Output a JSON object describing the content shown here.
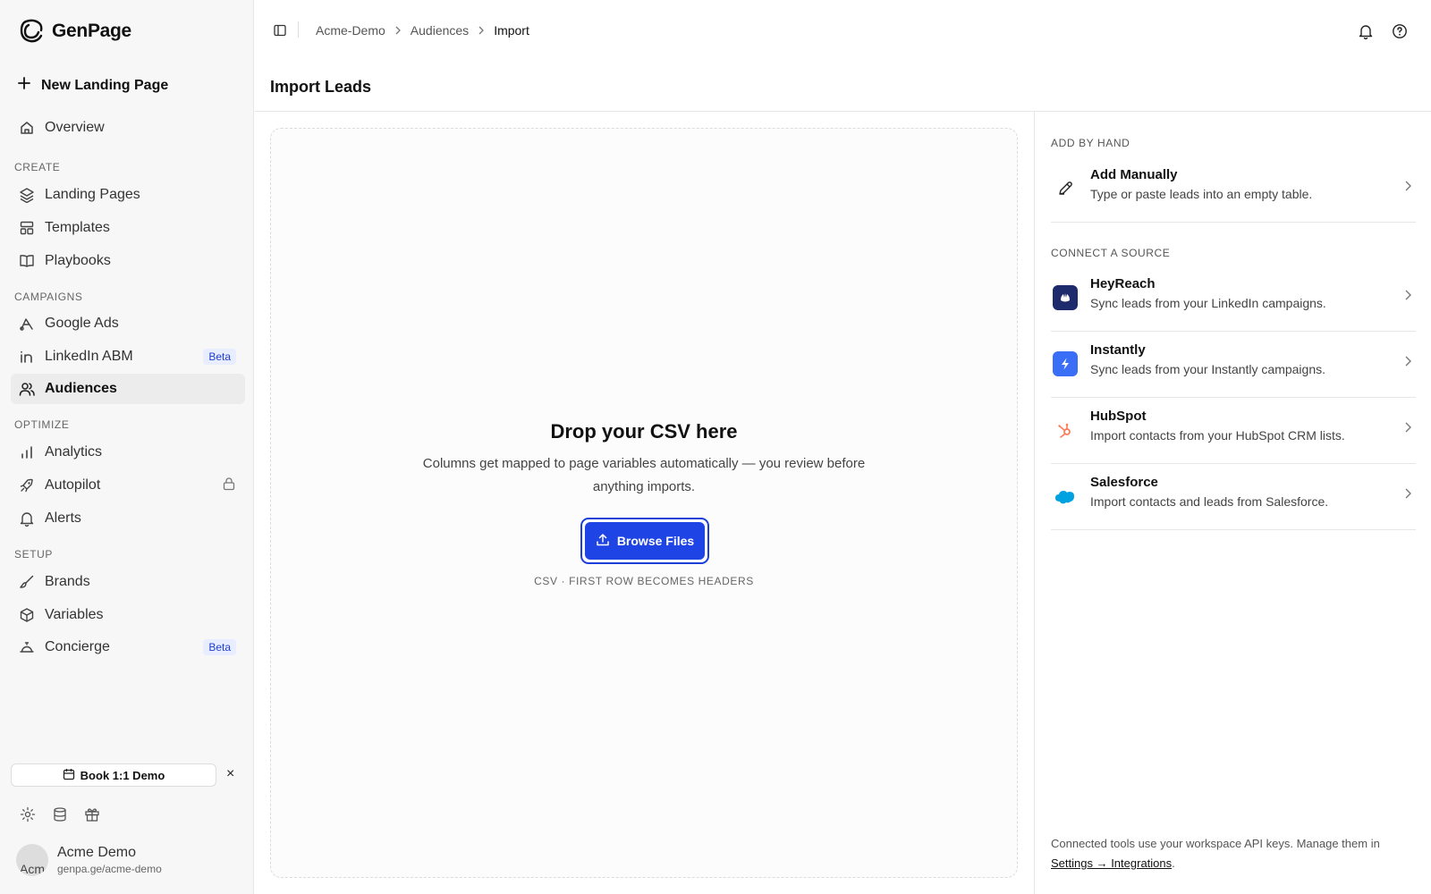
{
  "app": {
    "name": "GenPage"
  },
  "sidebar": {
    "new_page": "New Landing Page",
    "overview": "Overview",
    "sections": {
      "create": "CREATE",
      "campaigns": "CAMPAIGNS",
      "optimize": "OPTIMIZE",
      "setup": "SETUP"
    },
    "items": {
      "landing_pages": "Landing Pages",
      "templates": "Templates",
      "playbooks": "Playbooks",
      "google_ads": "Google Ads",
      "linkedin_abm": "LinkedIn ABM",
      "linkedin_badge": "Beta",
      "audiences": "Audiences",
      "analytics": "Analytics",
      "autopilot": "Autopilot",
      "alerts": "Alerts",
      "brands": "Brands",
      "variables": "Variables",
      "concierge": "Concierge",
      "concierge_badge": "Beta"
    },
    "demo_button": "Book 1:1 Demo",
    "demo_close": "×",
    "user": {
      "avatar_text": "Acm",
      "name": "Acme Demo",
      "url": "genpa.ge/acme-demo"
    }
  },
  "header": {
    "breadcrumb": [
      "Acme-Demo",
      "Audiences",
      "Import"
    ],
    "title": "Import Leads"
  },
  "dropzone": {
    "title": "Drop your CSV here",
    "description": "Columns get mapped to page variables automatically — you review before anything imports.",
    "button": "Browse Files",
    "hint": "CSV · FIRST ROW BECOMES HEADERS"
  },
  "right_panel": {
    "add_by_hand_label": "ADD BY HAND",
    "manual": {
      "title": "Add Manually",
      "description": "Type or paste leads into an empty table."
    },
    "connect_label": "CONNECT A SOURCE",
    "sources": [
      {
        "title": "HeyReach",
        "description": "Sync leads from your LinkedIn campaigns.",
        "icon": "heyreach-icon",
        "color": "#1d2a6b"
      },
      {
        "title": "Instantly",
        "description": "Sync leads from your Instantly campaigns.",
        "icon": "instantly-icon",
        "color": "#3b6ef6"
      },
      {
        "title": "HubSpot",
        "description": "Import contacts from your HubSpot CRM lists.",
        "icon": "hubspot-icon",
        "color": "#ff7a59"
      },
      {
        "title": "Salesforce",
        "description": "Import contacts and leads from Salesforce.",
        "icon": "salesforce-icon",
        "color": "#00a1e0"
      }
    ],
    "footer_text": "Connected tools use your workspace API keys. Manage them in ",
    "footer_link": "Settings → Integrations",
    "footer_end": "."
  },
  "colors": {
    "accent": "#1f44e6",
    "badge_bg": "#e8eeff",
    "badge_text": "#1f3fd6"
  }
}
